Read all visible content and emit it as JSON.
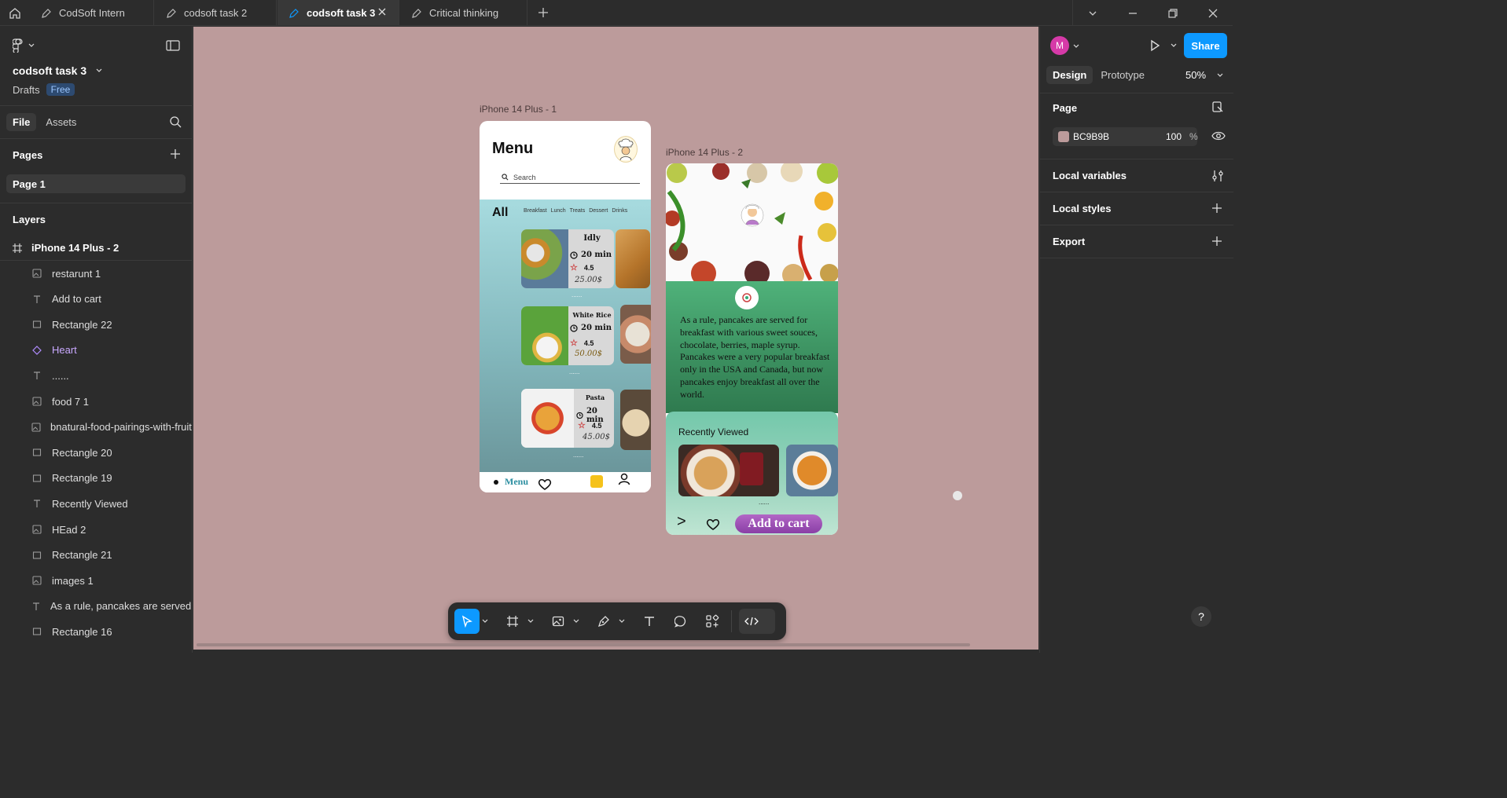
{
  "tabs": [
    {
      "label": "CodSoft Intern"
    },
    {
      "label": "codsoft task 2"
    },
    {
      "label": "codsoft task 3"
    },
    {
      "label": "Critical thinking"
    }
  ],
  "left_panel": {
    "file_name": "codsoft task 3",
    "drafts": "Drafts",
    "plan_badge": "Free",
    "file_tab": "File",
    "assets_tab": "Assets",
    "pages_heading": "Pages",
    "page_1": "Page 1",
    "layers_heading": "Layers",
    "frame_layer": "iPhone 14 Plus - 2",
    "layers": [
      {
        "name": "restarunt 1",
        "icon": "image-icon"
      },
      {
        "name": "Add to cart",
        "icon": "text-icon"
      },
      {
        "name": "Rectangle 22",
        "icon": "rectangle-icon"
      },
      {
        "name": "Heart",
        "icon": "component-icon"
      },
      {
        "name": "......",
        "icon": "text-icon"
      },
      {
        "name": "food 7 1",
        "icon": "image-icon"
      },
      {
        "name": "bnatural-food-pairings-with-fruit-",
        "icon": "image-icon"
      },
      {
        "name": "Rectangle 20",
        "icon": "rectangle-icon"
      },
      {
        "name": "Rectangle 19",
        "icon": "rectangle-icon"
      },
      {
        "name": "Recently Viewed",
        "icon": "text-icon"
      },
      {
        "name": "HEad 2",
        "icon": "image-icon"
      },
      {
        "name": "Rectangle 21",
        "icon": "rectangle-icon"
      },
      {
        "name": "images 1",
        "icon": "image-icon"
      },
      {
        "name": "As a rule, pancakes are served for",
        "icon": "text-icon"
      },
      {
        "name": "Rectangle 16",
        "icon": "rectangle-icon"
      }
    ]
  },
  "canvas": {
    "background": "#bc9b9b",
    "frame1_label": "iPhone 14 Plus - 1",
    "frame2_label": "iPhone 14 Plus - 2",
    "phone1": {
      "title": "Menu",
      "search_placeholder": "Search",
      "all": "All",
      "categories": [
        "Breakfast",
        "Lunch",
        "Treats",
        "Dessert",
        "Drinks"
      ],
      "cards": [
        {
          "name": "Idly",
          "time": "20 min",
          "rating": "4.5",
          "price": "25.00$"
        },
        {
          "name": "White Rice",
          "time": "20 min",
          "rating": "4.5",
          "price": "50.00$"
        },
        {
          "name": "Pasta",
          "time": "20 min",
          "rating": "4.5",
          "price": "45.00$"
        }
      ],
      "dots": "......",
      "nav_label": "Menu"
    },
    "phone2": {
      "logo_text": "Restaurant",
      "paragraph": "As a rule, pancakes are served for breakfast with various sweet souces, chocolate, berries,  maple syrup. Pancakes were a very popular breakfast only in the USA and Canada, but now pancakes enjoy breakfast all over the world.",
      "recently_viewed": "Recently Viewed",
      "dots": "......",
      "next_arrow": ">",
      "cta": "Add to cart"
    }
  },
  "right_panel": {
    "avatar_initial": "M",
    "share": "Share",
    "design_tab": "Design",
    "prototype_tab": "Prototype",
    "zoom": "50%",
    "page_heading": "Page",
    "page_color_hex": "BC9B9B",
    "page_color": "#bc9b9b",
    "opacity": "100",
    "opacity_unit": "%",
    "local_variables": "Local variables",
    "local_styles": "Local styles",
    "export": "Export",
    "help": "?"
  },
  "accent_color": "#0d99ff"
}
